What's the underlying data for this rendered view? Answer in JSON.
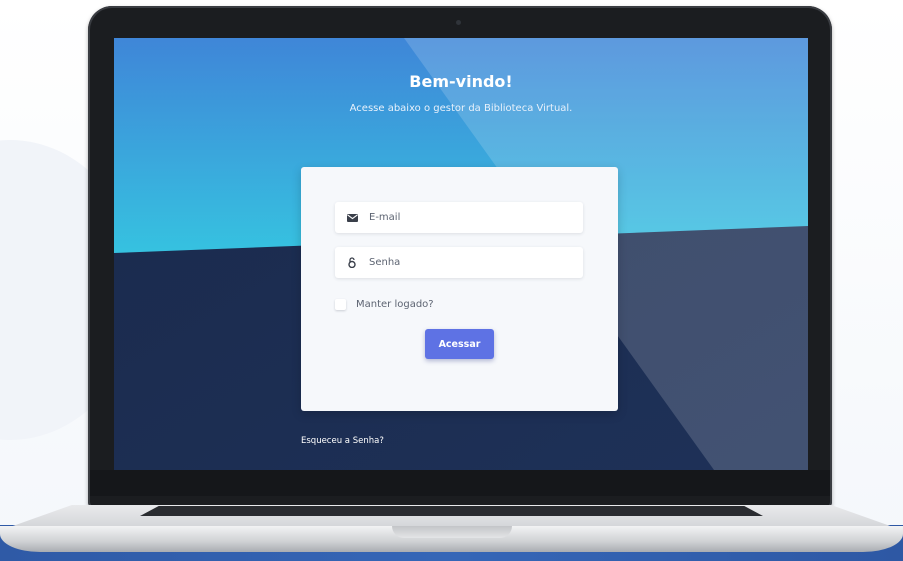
{
  "page": {
    "title": "Bem-vindo!",
    "subtitle": "Acesse abaixo o gestor da Biblioteca Virtual."
  },
  "login_form": {
    "email": {
      "placeholder": "E-mail",
      "icon": "envelope-icon"
    },
    "password": {
      "placeholder": "Senha",
      "icon": "lock-icon"
    },
    "remember_label": "Manter logado?",
    "submit_label": "Acessar"
  },
  "forgot_password_link": "Esqueceu a Senha?",
  "colors": {
    "accent": "#5e72e4",
    "sky_top": "#3f86d8",
    "sky_bottom": "#36c2e0",
    "navy": "#1c2c4f",
    "card": "#f6f8fb"
  }
}
